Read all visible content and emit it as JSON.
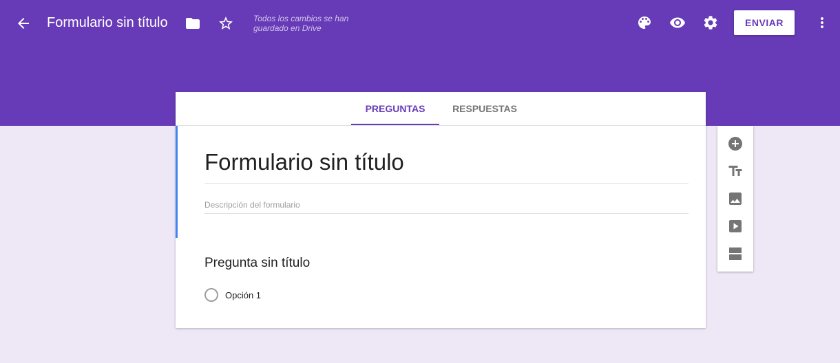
{
  "header": {
    "title": "Formulario sin título",
    "save_status": "Todos los cambios se han guardado en Drive",
    "send_label": "ENVIAR",
    "icons": [
      "back-arrow-icon",
      "folder-icon",
      "star-icon",
      "palette-icon",
      "eye-icon",
      "gear-icon",
      "more-vert-icon"
    ],
    "accent_color": "#673ab7"
  },
  "tabs": [
    {
      "label": "PREGUNTAS",
      "active": true
    },
    {
      "label": "RESPUESTAS",
      "active": false
    }
  ],
  "form": {
    "title": "Formulario sin título",
    "description_placeholder": "Descripción del formulario",
    "accent_color": "#4285f4"
  },
  "question": {
    "title": "Pregunta sin título",
    "options": [
      "Opción 1"
    ]
  },
  "toolbar": {
    "icons": [
      "add-question-icon",
      "title-text-icon",
      "image-icon",
      "video-icon",
      "section-icon"
    ]
  }
}
